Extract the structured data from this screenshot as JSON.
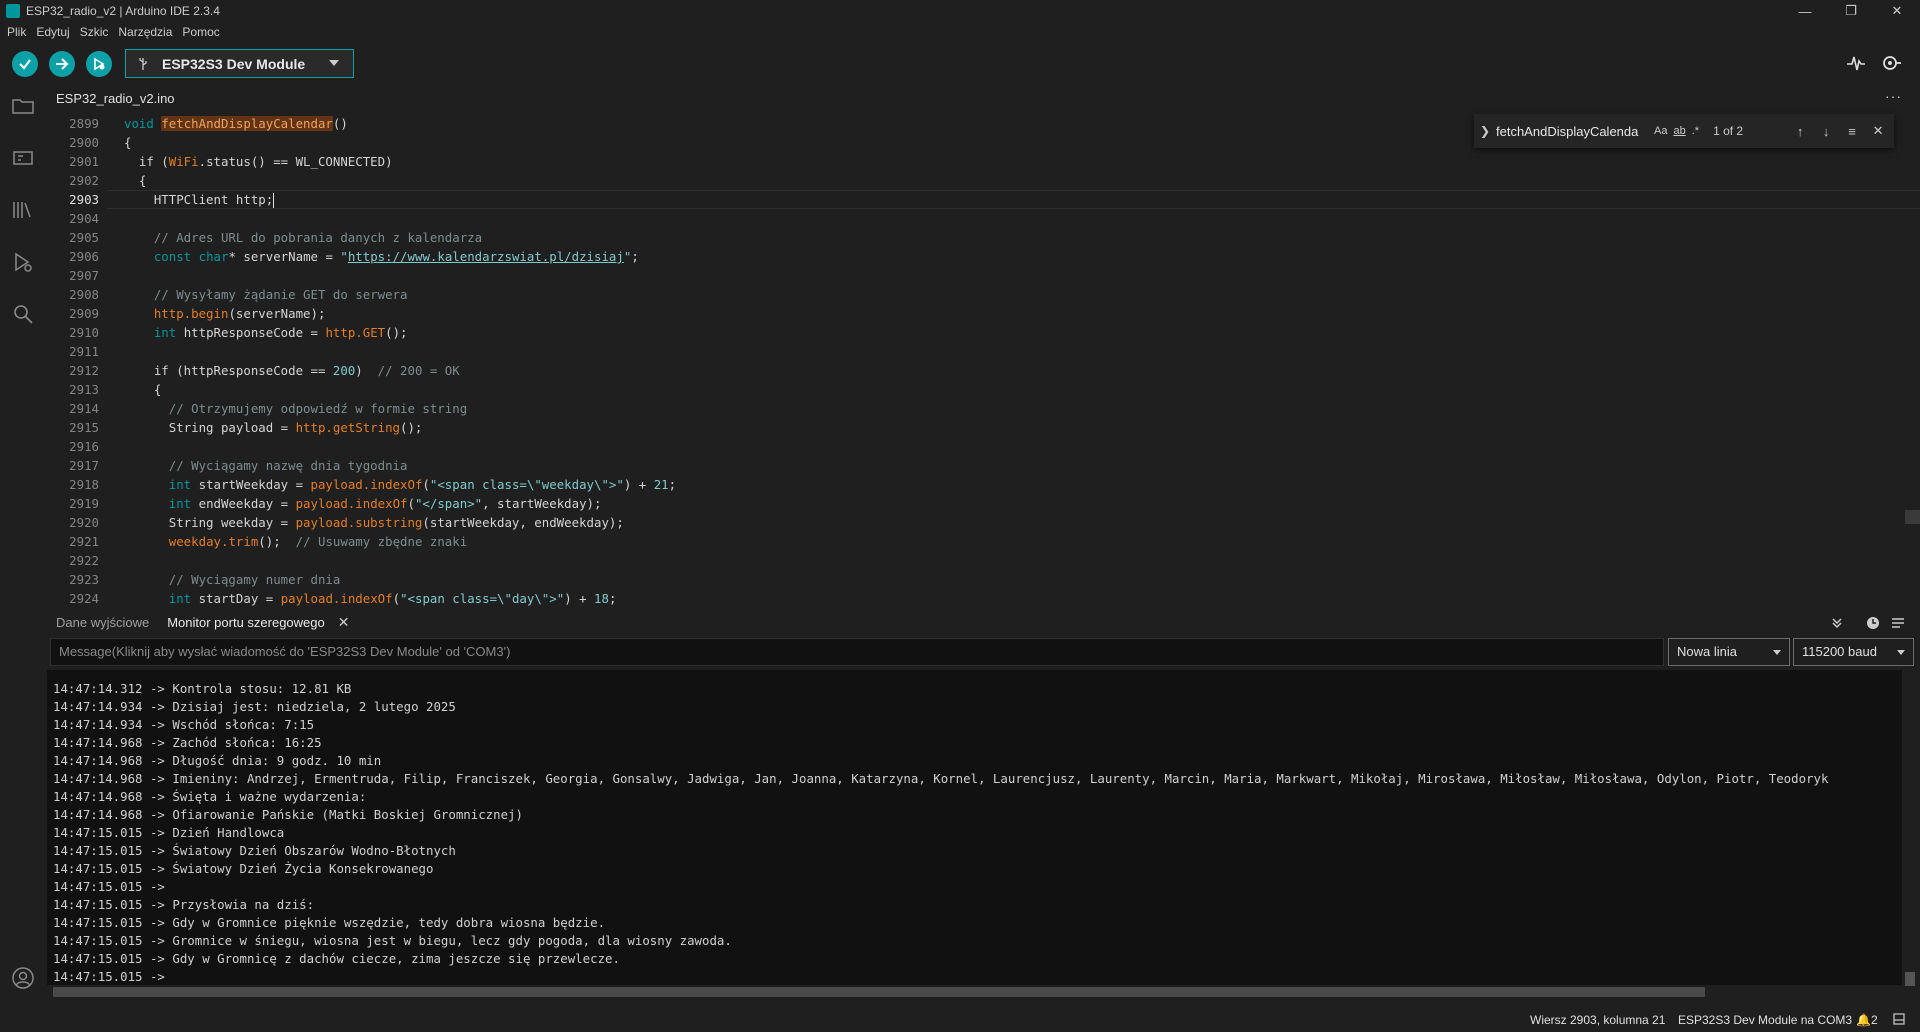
{
  "window": {
    "title": "ESP32_radio_v2 | Arduino IDE 2.3.4",
    "minimize": "—",
    "maximize": "❐",
    "close": "✕"
  },
  "menu": [
    "Plik",
    "Edytuj",
    "Szkic",
    "Narzędzia",
    "Pomoc"
  ],
  "toolbar": {
    "board": "ESP32S3 Dev Module",
    "verify_icon": "check-icon",
    "upload_icon": "arrow-right-icon",
    "debug_icon": "debug-icon",
    "serial_plotter_icon": "plotter-icon",
    "serial_monitor_icon": "serial-monitor-icon"
  },
  "file_tab": "ESP32_radio_v2.ino",
  "find": {
    "term": "fetchAndDisplayCalenda",
    "match_case": "Aa",
    "whole_word": "ab",
    "regex": ".*",
    "count": "1 of 2"
  },
  "editor": {
    "current_line": 2903,
    "lines": [
      {
        "n": "2899"
      },
      {
        "n": "2900"
      },
      {
        "n": "2901"
      },
      {
        "n": "2902"
      },
      {
        "n": "2903"
      },
      {
        "n": "2904"
      },
      {
        "n": "2905"
      },
      {
        "n": "2906"
      },
      {
        "n": "2907"
      },
      {
        "n": "2908"
      },
      {
        "n": "2909"
      },
      {
        "n": "2910"
      },
      {
        "n": "2911"
      },
      {
        "n": "2912"
      },
      {
        "n": "2913"
      },
      {
        "n": "2914"
      },
      {
        "n": "2915"
      },
      {
        "n": "2916"
      },
      {
        "n": "2917"
      },
      {
        "n": "2918"
      },
      {
        "n": "2919"
      },
      {
        "n": "2920"
      },
      {
        "n": "2921"
      },
      {
        "n": "2922"
      },
      {
        "n": "2923"
      },
      {
        "n": "2924"
      }
    ],
    "code": {
      "l2899_kw": "void",
      "l2899_fn": "fetchAndDisplayCalendar",
      "l2899_rest": "()",
      "l2900": "{",
      "l2901_a": "  if (",
      "l2901_b": "WiFi",
      "l2901_c": ".status() == WL_CONNECTED)",
      "l2902": "  {",
      "l2903": "    HTTPClient http;",
      "l2905": "    // Adres URL do pobrania danych z kalendarza",
      "l2906_a": "const",
      "l2906_b": "char",
      "l2906_c": "* serverName = ",
      "l2906_q1": "\"",
      "l2906_url": "https://www.kalendarzswiat.pl/dzisiaj",
      "l2906_q2": "\"",
      "l2906_d": ";",
      "l2908": "    // Wysyłamy żądanie GET do serwera",
      "l2909_a": "http.begin",
      "l2909_b": "(serverName);",
      "l2910_a": "int",
      "l2910_b": " httpResponseCode = ",
      "l2910_c": "http.GET",
      "l2910_d": "();",
      "l2912_a": "    if (httpResponseCode == ",
      "l2912_b": "200",
      "l2912_c": ")  ",
      "l2912_d": "// 200 = OK",
      "l2913": "    {",
      "l2914": "      // Otrzymujemy odpowiedź w formie string",
      "l2915_a": "      String payload = ",
      "l2915_b": "http.getString",
      "l2915_c": "();",
      "l2917": "      // Wyciągamy nazwę dnia tygodnia",
      "l2918_a": "int",
      "l2918_b": " startWeekday = ",
      "l2918_c": "payload.indexOf",
      "l2918_d": "(",
      "l2918_e": "\"<span class=\\\"weekday\\\">\"",
      "l2918_f": ") + ",
      "l2918_g": "21",
      "l2918_h": ";",
      "l2919_a": "int",
      "l2919_b": " endWeekday = ",
      "l2919_c": "payload.indexOf",
      "l2919_d": "(",
      "l2919_e": "\"</span>\"",
      "l2919_f": ", startWeekday);",
      "l2920_a": "      String weekday = ",
      "l2920_b": "payload.substring",
      "l2920_c": "(startWeekday, endWeekday);",
      "l2921_a": "weekday.trim",
      "l2921_b": "();  ",
      "l2921_c": "// Usuwamy zbędne znaki",
      "l2923": "      // Wyciągamy numer dnia",
      "l2924_a": "int",
      "l2924_b": " startDay = ",
      "l2924_c": "payload.indexOf",
      "l2924_d": "(",
      "l2924_e": "\"<span class=\\\"day\\\">\"",
      "l2924_f": ") + ",
      "l2924_g": "18",
      "l2924_h": ";"
    }
  },
  "panel": {
    "tab_output": "Dane wyjściowe",
    "tab_serial": "Monitor portu szeregowego",
    "message_placeholder": "Message(Kliknij aby wysłać wiadomość do 'ESP32S3 Dev Module' od 'COM3')",
    "line_ending": "Nowa linia",
    "baud": "115200 baud",
    "serial_lines": [
      "14:47:14.312 -> Kontrola stosu: 12.81 KB",
      "14:47:14.934 -> Dzisiaj jest: niedziela, 2 lutego 2025",
      "14:47:14.934 -> Wschód słońca: 7:15",
      "14:47:14.968 -> Zachód słońca: 16:25",
      "14:47:14.968 -> Długość dnia: 9 godz. 10 min",
      "14:47:14.968 -> Imieniny: Andrzej, Ermentruda, Filip, Franciszek, Georgia, Gonsalwy, Jadwiga, Jan, Joanna, Katarzyna, Kornel, Laurencjusz, Laurenty, Marcin, Maria, Markwart, Mikołaj, Mirosława, Miłosław, Miłosława, Odylon, Piotr, Teodoryk",
      "14:47:14.968 -> Święta i ważne wydarzenia:",
      "14:47:14.968 -> Ofiarowanie Pańskie (Matki Boskiej Gromnicznej)",
      "14:47:15.015 -> Dzień Handlowca",
      "14:47:15.015 -> Światowy Dzień Obszarów Wodno-Błotnych",
      "14:47:15.015 -> Światowy Dzień Życia Konsekrowanego",
      "14:47:15.015 -> ",
      "14:47:15.015 -> Przysłowia na dziś:",
      "14:47:15.015 -> Gdy w Gromnice pięknie wszędzie, tedy dobra wiosna będzie.",
      "14:47:15.015 -> Gromnice w śniegu, wiosna jest w biegu, lecz gdy pogoda, dla wiosny zawoda.",
      "14:47:15.015 -> Gdy w Gromnicę z dachów ciecze, zima jeszcze się przewlecze.",
      "14:47:15.015 -> "
    ]
  },
  "status": {
    "position": "Wiersz 2903, kolumna 21",
    "board_port": "ESP32S3 Dev Module na COM3",
    "notifications": "2"
  },
  "colors": {
    "accent": "#0ca1a6",
    "keyword": "#00979d",
    "function": "#e67e22",
    "comment": "#7f8c8d",
    "background": "#1f1f1f"
  }
}
